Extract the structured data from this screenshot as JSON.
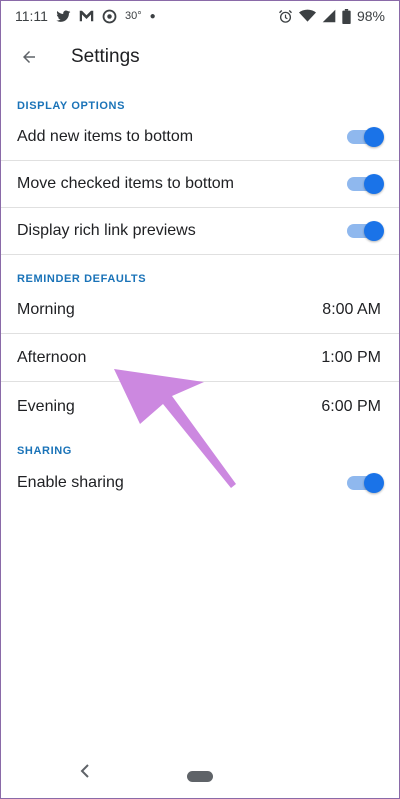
{
  "status_bar": {
    "time": "11:11",
    "temperature": "30°",
    "battery": "98%",
    "left_icons": [
      "twitter-icon",
      "gmail-icon",
      "app-icon"
    ],
    "right_icons": [
      "alarm-icon",
      "wifi-icon",
      "signal-icon",
      "battery-icon"
    ]
  },
  "header": {
    "title": "Settings",
    "back_icon": "arrow-back-icon"
  },
  "sections": {
    "display": {
      "label": "DISPLAY OPTIONS",
      "items": [
        {
          "label": "Add new items to bottom",
          "enabled": true
        },
        {
          "label": "Move checked items to bottom",
          "enabled": true
        },
        {
          "label": "Display rich link previews",
          "enabled": true
        }
      ]
    },
    "reminders": {
      "label": "REMINDER DEFAULTS",
      "items": [
        {
          "label": "Morning",
          "value": "8:00 AM"
        },
        {
          "label": "Afternoon",
          "value": "1:00 PM"
        },
        {
          "label": "Evening",
          "value": "6:00 PM"
        }
      ]
    },
    "sharing": {
      "label": "SHARING",
      "items": [
        {
          "label": "Enable sharing",
          "enabled": true
        }
      ]
    }
  },
  "colors": {
    "accent": "#1a73e8",
    "section_label": "#1a73b8",
    "toggle_track": "#8fb8ee",
    "annotation_arrow": "#cc88e0"
  }
}
